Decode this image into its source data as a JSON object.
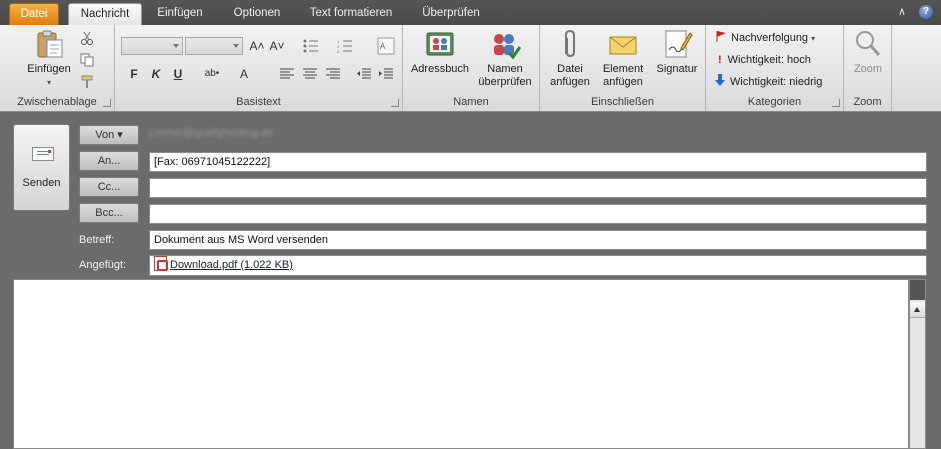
{
  "tabs": {
    "file": "Datei",
    "message": "Nachricht",
    "insert": "Einfügen",
    "options": "Optionen",
    "format_text": "Text formatieren",
    "review": "Überprüfen"
  },
  "window_controls": {
    "minimize_ribbon": "∧",
    "help": "?"
  },
  "ribbon": {
    "clipboard": {
      "label": "Zwischenablage",
      "paste": "Einfügen",
      "paste_arrow": "▾"
    },
    "basic_text": {
      "label": "Basistext",
      "bold": "F",
      "italic": "K",
      "underline": "U",
      "grow_font": "A˄",
      "shrink_font": "A˅",
      "highlight": "ab•",
      "font_color": "A"
    },
    "names": {
      "label": "Namen",
      "address_book": "Adressbuch",
      "check_names_1": "Namen",
      "check_names_2": "überprüfen"
    },
    "include": {
      "label": "Einschließen",
      "attach_file_1": "Datei",
      "attach_file_2": "anfügen",
      "attach_item_1": "Element",
      "attach_item_2": "anfügen",
      "signature": "Signatur"
    },
    "tags": {
      "label": "Kategorien",
      "follow_up": "Nachverfolgung",
      "high_importance": "Wichtigkeit: hoch",
      "low_importance": "Wichtigkeit: niedrig"
    },
    "zoom": {
      "label": "Zoom",
      "zoom": "Zoom"
    }
  },
  "compose": {
    "send": "Senden",
    "from_button": "Von ▾",
    "from_value": "j.mmer@quallyhosting.de",
    "to_button": "An...",
    "to_value": "[Fax: 06971045122222]",
    "cc_button": "Cc...",
    "cc_value": "",
    "bcc_button": "Bcc...",
    "bcc_value": "",
    "subject_label": "Betreff:",
    "subject_value": "Dokument aus MS Word versenden",
    "attached_label": "Angefügt:",
    "attachment_name": "Download.pdf (1.022 KB)"
  },
  "colors": {
    "file_tab": "#e07d10",
    "workspace": "#6b6b6b"
  }
}
